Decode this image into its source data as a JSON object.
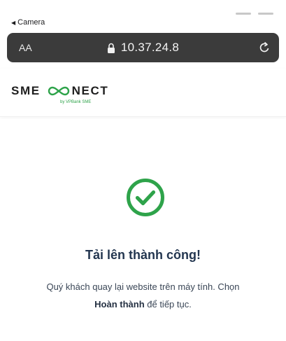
{
  "status_bar": {
    "back_label": "Camera"
  },
  "address_bar": {
    "aa_label": "AA",
    "url": "10.37.24.8"
  },
  "header": {
    "logo_text_left": "SME",
    "logo_text_right": "NECT",
    "logo_sub": "by VPBank SME"
  },
  "main": {
    "title": "Tải lên thành công!",
    "message_part1": "Quý khách quay lại website trên máy tính. Chọn",
    "message_bold": "Hoàn thành",
    "message_part2": " để tiếp tục."
  },
  "colors": {
    "success_green": "#2ea34a",
    "title_navy": "#233650",
    "address_bar_bg": "#3b3b3b"
  },
  "icons": {
    "lock": "lock-icon",
    "reload": "reload-icon",
    "success": "check-circle-icon",
    "back": "back-arrow-icon"
  }
}
